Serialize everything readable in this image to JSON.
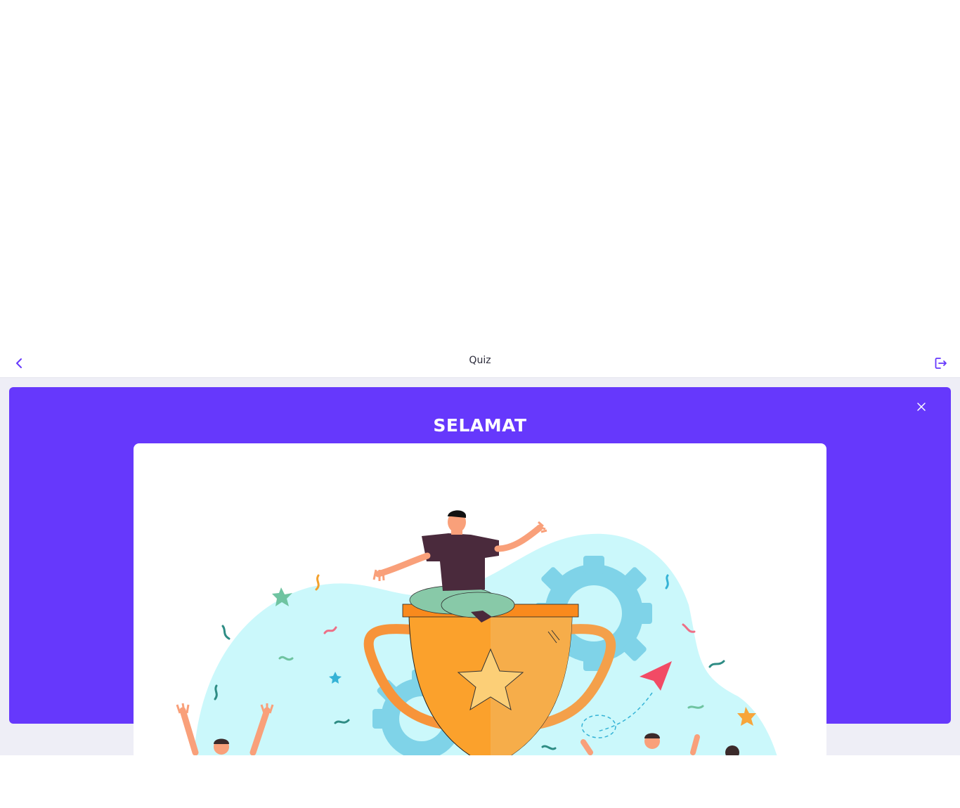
{
  "header": {
    "title": "Quiz",
    "back_icon": "chevron-left-icon",
    "exit_icon": "logout-icon",
    "accent_color": "#6638fc"
  },
  "modal": {
    "title": "SELAMAT",
    "close_icon": "close-icon",
    "background_color": "#6638fc",
    "illustration": "trophy-celebration-illustration"
  }
}
